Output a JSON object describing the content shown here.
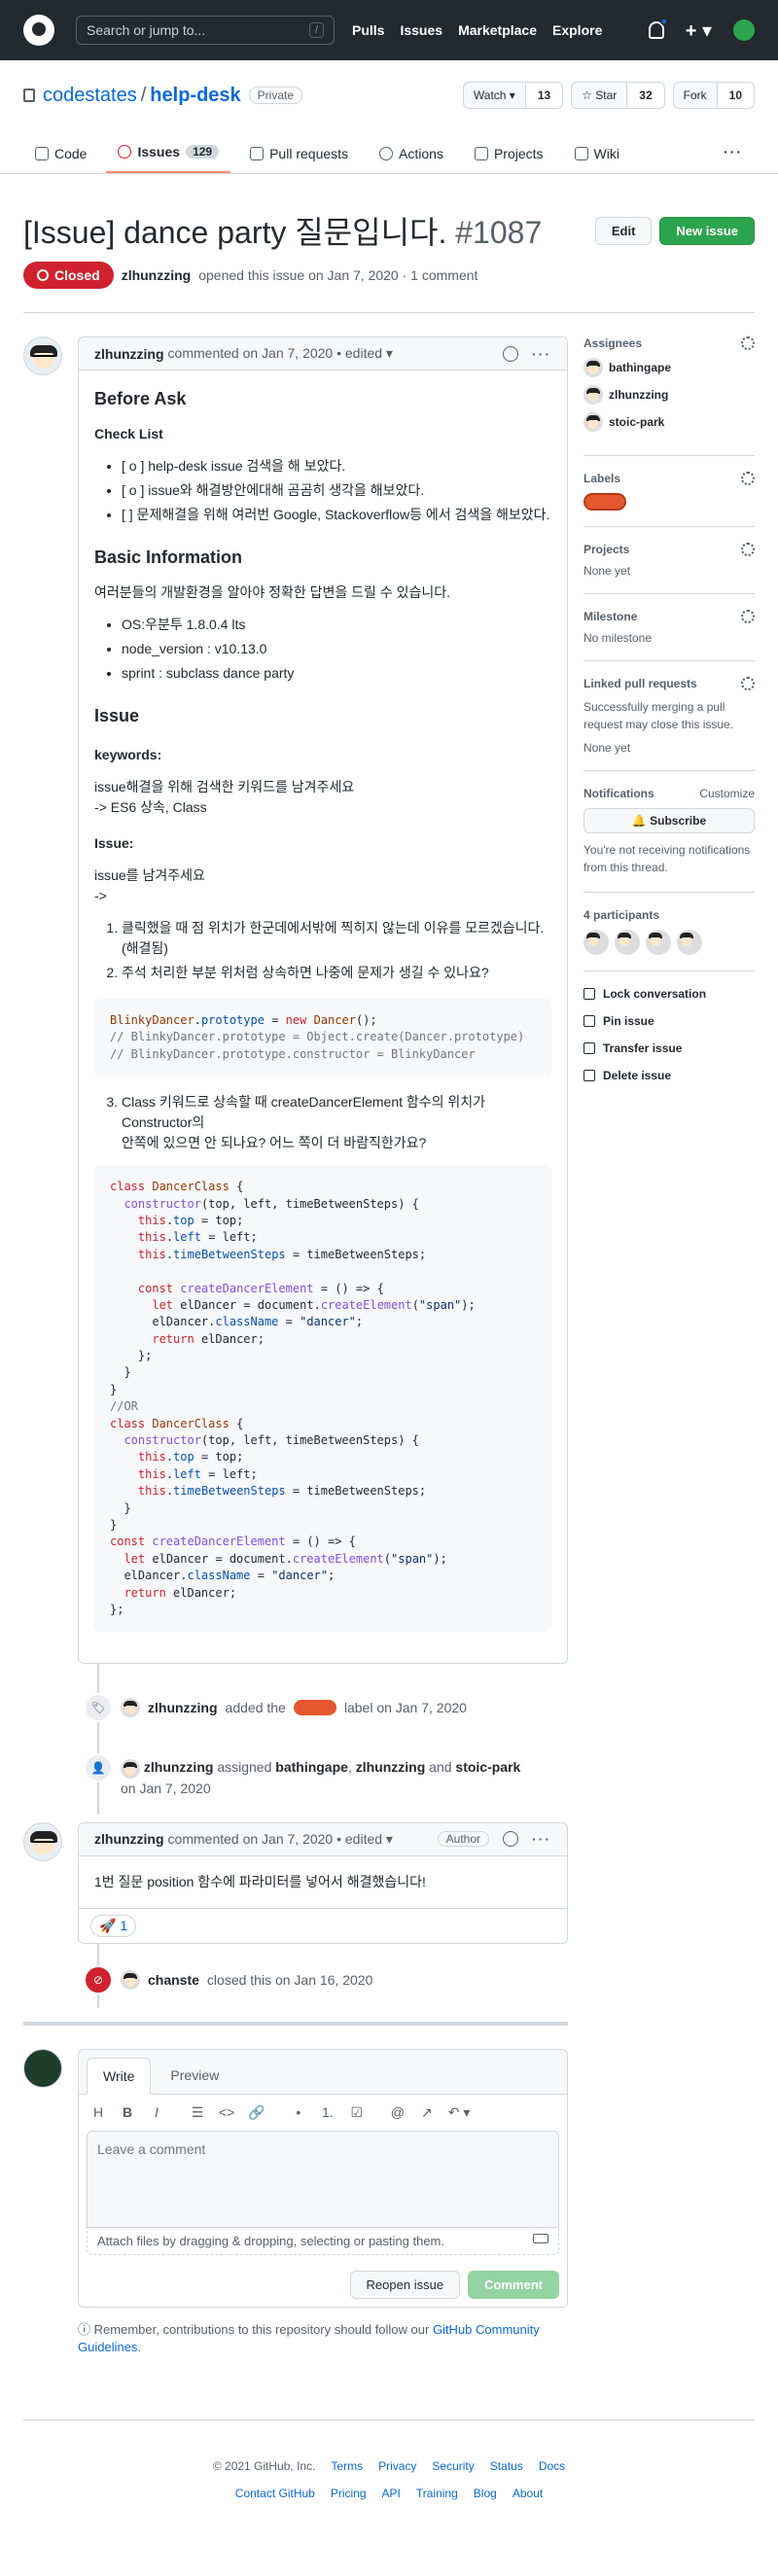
{
  "header": {
    "search_placeholder": "Search or jump to...",
    "slash": "/",
    "nav": [
      "Pulls",
      "Issues",
      "Marketplace",
      "Explore"
    ],
    "plus": "+ ▾"
  },
  "repo": {
    "owner": "codestates",
    "sep": "/",
    "name": "help-desk",
    "visibility": "Private",
    "watch_label": "Watch ▾",
    "watch_count": "13",
    "star_label": "☆ Star",
    "star_count": "32",
    "fork_label": "Fork",
    "fork_count": "10",
    "tabs": [
      {
        "label": "Code"
      },
      {
        "label": "Issues",
        "count": "129"
      },
      {
        "label": "Pull requests"
      },
      {
        "label": "Actions"
      },
      {
        "label": "Projects"
      },
      {
        "label": "Wiki"
      }
    ],
    "more": "···"
  },
  "issue": {
    "title": "[Issue] dance party 질문입니다.",
    "number": "#1087",
    "edit_label": "Edit",
    "new_issue_label": "New issue",
    "state": "Closed",
    "author": "zlhunzzing",
    "opened_text": "opened this issue on Jan 7, 2020 · 1 comment"
  },
  "comment1": {
    "author": "zlhunzzing",
    "meta": "commented on Jan 7, 2020 • edited ▾",
    "h_before": "Before Ask",
    "h_checklist": "Check List",
    "checklist": [
      "[ o ] help-desk issue 검색을 해 보았다.",
      "[ o ] issue와 해결방안에대해 곰곰히 생각을 해보았다.",
      "[ ] 문제해결을 위해 여러번 Google, Stackoverflow등 에서 검색을 해보았다."
    ],
    "h_basic": "Basic Information",
    "basic_intro": "여러분들의 개발환경을 알아야 정확한 답변을 드릴 수 있습니다.",
    "basic_list": [
      "OS:우분투 1.8.0.4 lts",
      "node_version : v10.13.0",
      "sprint : subclass dance party"
    ],
    "h_issue": "Issue",
    "h_keywords": "keywords:",
    "keywords_line1": "issue해결을 위해 검색한 키워드를 남겨주세요",
    "keywords_line2": "-> ES6 상속, Class",
    "h_issue2": "Issue:",
    "issue_line1": "issue를 남겨주세요",
    "issue_line2": "->",
    "q1": "클릭했을 때 점 위치가 한군데에서밖에 찍히지 않는데 이유를 모르겠습니다.(해결됨)",
    "q2": "주석 처리한 부분 위처럼 상속하면 나중에 문제가 생길 수 있나요?",
    "q3a": "Class 키워드로 상속할 때 createDancerElement 함수의 위치가 Constructor의",
    "q3b": "안쪽에 있으면 안 되나요? 어느 쪽이 더 바람직한가요?"
  },
  "events": {
    "label_actor": "zlhunzzing",
    "label_text1": "added the",
    "label_text2": "label on Jan 7, 2020",
    "assign_actor": "zlhunzzing",
    "assign_text1": "assigned",
    "assign_u1": "bathingape",
    "assign_sep": ",",
    "assign_u2": "zlhunzzing",
    "assign_and": "and",
    "assign_u3": "stoic-park",
    "assign_date": "on Jan 7, 2020",
    "closed_actor": "chanste",
    "closed_text": "closed this on Jan 16, 2020"
  },
  "comment2": {
    "author": "zlhunzzing",
    "meta": "commented on Jan 7, 2020 • edited ▾",
    "badge": "Author",
    "body": "1번 질문 position 함수에 파라미터를 넣어서 해결했습니다!",
    "reaction": "🚀 1"
  },
  "composer": {
    "tab_write": "Write",
    "tab_preview": "Preview",
    "tools": [
      "H",
      "B",
      "I",
      "☰",
      "<>",
      "🔗",
      "•",
      "1.",
      "☑",
      "@",
      "↗",
      "↶ ▾"
    ],
    "placeholder": "Leave a comment",
    "attach": "Attach files by dragging & dropping, selecting or pasting them.",
    "reopen_label": "Reopen issue",
    "comment_label": "Comment",
    "remember": "Remember, contributions to this repository should follow our",
    "remember_link": "GitHub Community Guidelines",
    "remember_end": "."
  },
  "sidebar": {
    "assignees_title": "Assignees",
    "assignees": [
      "bathingape",
      "zlhunzzing",
      "stoic-park"
    ],
    "labels_title": "Labels",
    "projects_title": "Projects",
    "projects_value": "None yet",
    "milestone_title": "Milestone",
    "milestone_value": "No milestone",
    "linked_title": "Linked pull requests",
    "linked_desc": "Successfully merging a pull request may close this issue.",
    "linked_value": "None yet",
    "notif_title": "Notifications",
    "notif_customize": "Customize",
    "subscribe_label": "🔔 Subscribe",
    "notif_desc": "You're not receiving notifications from this thread.",
    "participants_title": "4 participants",
    "lock_label": "Lock conversation",
    "pin_label": "Pin issue",
    "transfer_label": "Transfer issue",
    "delete_label": "Delete issue"
  },
  "footer": {
    "copyright": "© 2021 GitHub, Inc.",
    "row1": [
      "Terms",
      "Privacy",
      "Security",
      "Status",
      "Docs"
    ],
    "row2": [
      "Contact GitHub",
      "Pricing",
      "API",
      "Training",
      "Blog",
      "About"
    ]
  },
  "colors": {
    "accent": "#0969da",
    "closed": "#cf222e",
    "green": "#2da44e",
    "label": "#e4572e"
  }
}
